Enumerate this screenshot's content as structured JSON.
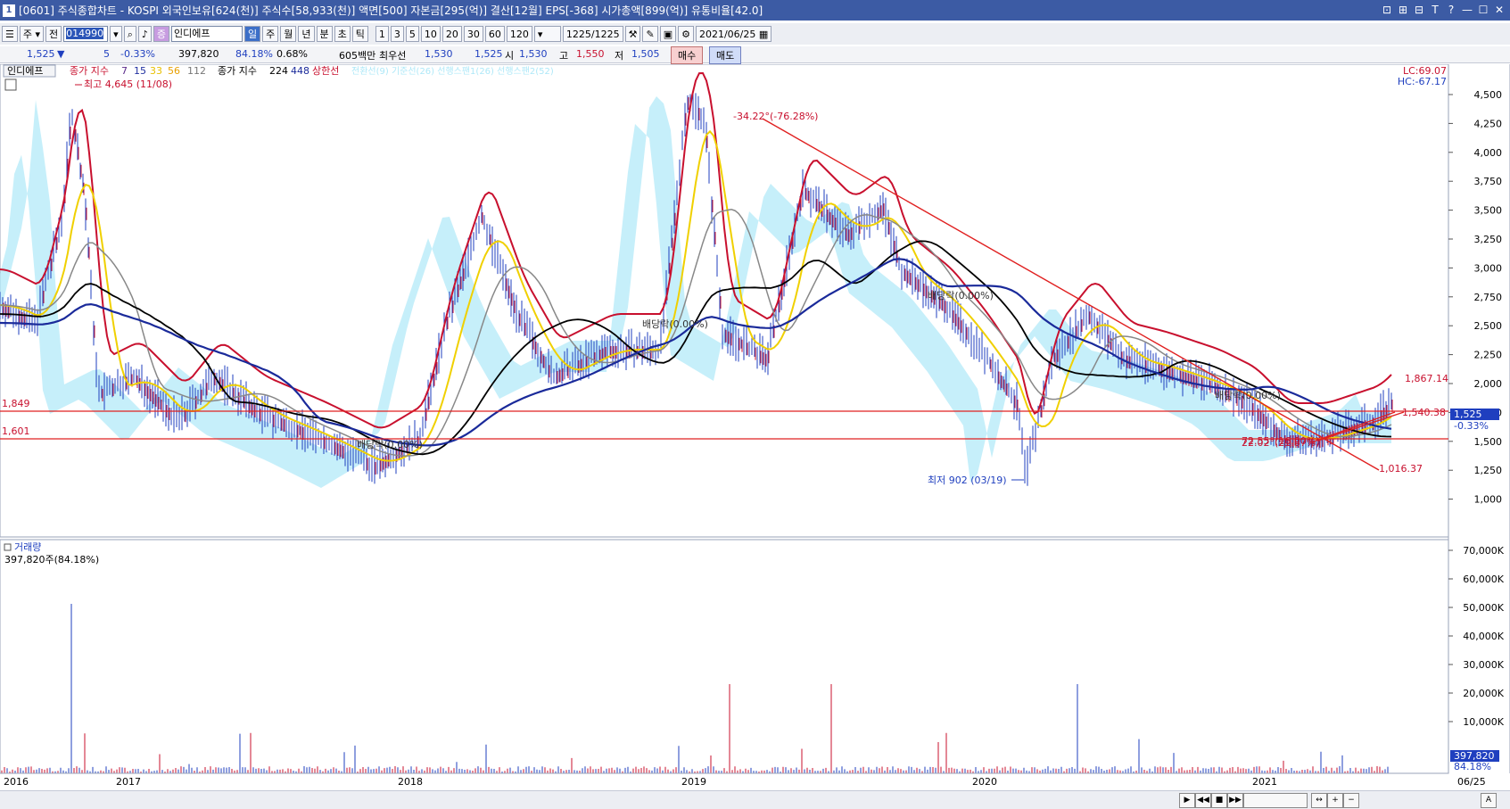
{
  "window": {
    "title": "[0601] 주식종합차트 - KOSPI 외국인보유[624(천)] 주식수[58,933(천)] 액면[500] 자본금[295(억)] 결산[12월] EPS[-368] 시가총액[899(억)] 유통비율[42.0]",
    "app_icon": "1",
    "controls": [
      "⊡",
      "⊞",
      "⊟",
      "T",
      "?",
      "—",
      "☐",
      "✕"
    ]
  },
  "toolbar": {
    "type_select": "주",
    "prev_label": "전",
    "code": "014990",
    "stock_name": "인디에프",
    "stock_badge": "증",
    "periods": [
      "일",
      "주",
      "월",
      "년",
      "분",
      "초",
      "틱"
    ],
    "active_period": "일",
    "intervals": [
      "1",
      "3",
      "5",
      "10",
      "20",
      "30",
      "60",
      "120"
    ],
    "count": "1225",
    "count_total": "/1225",
    "date": "2021/06/25"
  },
  "quote": {
    "price": "1,525",
    "arrow": "▼",
    "change": "5",
    "change_pct": "-0.33%",
    "volume": "397,820",
    "vol_pct": "84.18%",
    "turnover": "0.68%",
    "amount": "605백만",
    "best_label": "최우선",
    "best_ask": "1,530",
    "best_bid": "1,525",
    "open_label": "시",
    "open": "1,530",
    "high_label": "고",
    "high": "1,550",
    "low_label": "저",
    "low": "1,505",
    "buy": "매수",
    "sell": "매도"
  },
  "legend": {
    "name": "인디에프",
    "ma_label": "종가 지수",
    "ma_short": [
      "7",
      "15",
      "33",
      "56",
      "112"
    ],
    "ma_long_label": "종가 지수",
    "ma_long": [
      "224",
      "448"
    ],
    "upper": "상한선",
    "extra": "전환선(9) 기준선(26) 선행스팬1(26) 선행스팬2(52)"
  },
  "price_panel": {
    "lc": "LC:69.07",
    "hc": "HC:-67.17",
    "y_ticks": [
      "4,500",
      "4,250",
      "4,000",
      "3,750",
      "3,500",
      "3,250",
      "3,000",
      "2,750",
      "2,500",
      "2,250",
      "2,000",
      "1,750",
      "1,500",
      "1,250",
      "1,000"
    ],
    "current_tag": "1,525",
    "current_pct": "-0.33%",
    "h_line_1": "1,849",
    "h_line_2": "1,601",
    "high_label": "최고 4,645 (11/08)",
    "low_label": "최저 902 (03/19)",
    "trend_label_1": "-34.22°(-76.28%)",
    "trend_label_2": "22.02°(21.87%)",
    "trend_label_3": "72.55°(16.00%)",
    "right_label_1": "1,867.14",
    "right_label_2": "1,540.38",
    "right_label_3": "1,016.37",
    "dividend_1": "배당락(0.00%)",
    "dividend_2": "배당락(0.00%)",
    "dividend_3": "배당락(0.00%)",
    "dividend_4": "배당락(0.00%)"
  },
  "volume_panel": {
    "title": "거래량",
    "value": "397,820주(84.18%)",
    "y_ticks": [
      "70,000K",
      "60,000K",
      "50,000K",
      "40,000K",
      "30,000K",
      "20,000K",
      "10,000K"
    ],
    "current_tag": "397,820",
    "current_pct": "84.18%"
  },
  "x_axis": {
    "labels": [
      "2016",
      "2017",
      "2018",
      "2019",
      "2020",
      "2021"
    ],
    "end_label": "06/25"
  },
  "colors": {
    "title_bar": "#3c5ba4",
    "price_red": "#c8102e",
    "price_blue": "#1f3fbf",
    "ma_yellow": "#f0d000",
    "ma_black": "#000000",
    "ma_navy": "#1a2a9a",
    "cloud": "#aee8f8",
    "trend_red": "#e02020"
  }
}
